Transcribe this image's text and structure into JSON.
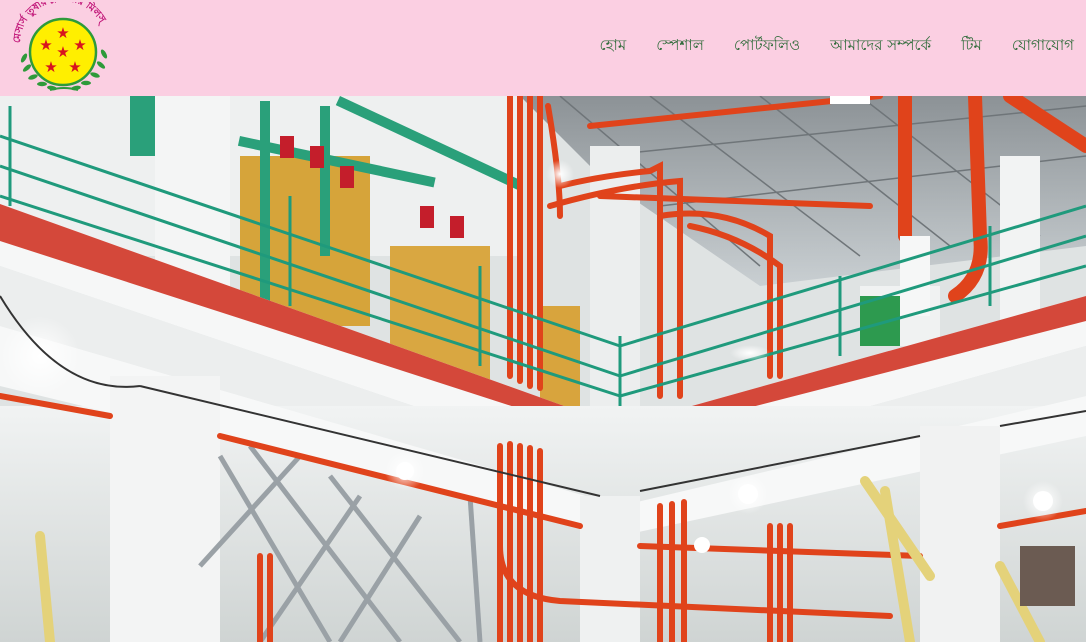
{
  "brand": {
    "logo_text": "মেসার্স তুষার ফ্লাওয়ার মিলস্",
    "logo_icon": "stars-emblem-icon",
    "colors": {
      "ring": "#c2187a",
      "disc": "#ffef00",
      "stars": "#d8141e",
      "laurel": "#2e9a3a"
    }
  },
  "nav": {
    "items": [
      {
        "label": "হোম"
      },
      {
        "label": "স্পেশাল"
      },
      {
        "label": "পোর্টফলিও"
      },
      {
        "label": "আমাদের সম্পর্কে"
      },
      {
        "label": "টিম"
      },
      {
        "label": "যোগাযোগ"
      }
    ]
  },
  "hero": {
    "image": "flour-mill-interior-photo"
  },
  "theme": {
    "navbar_bg": "#fbcfe2",
    "nav_text": "#2f6b3a",
    "pipe_orange": "#e0431b",
    "railing_green": "#1f9a7c"
  }
}
